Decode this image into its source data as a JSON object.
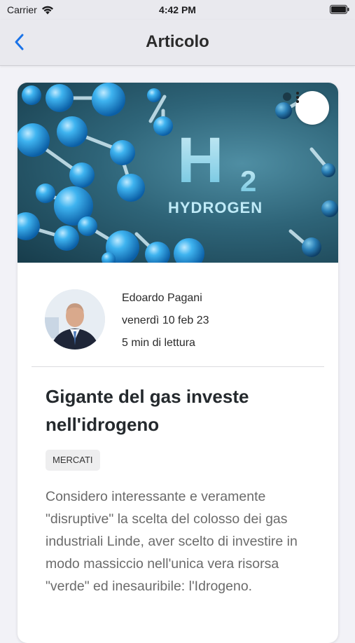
{
  "status_bar": {
    "carrier": "Carrier",
    "time": "4:42 PM"
  },
  "nav": {
    "title": "Articolo",
    "back_icon": "chevron-left-icon",
    "accent": "#1a73e8"
  },
  "article": {
    "hero": {
      "image_caption_h": "H",
      "image_caption_sub": "2",
      "image_caption_word": "HYDROGEN",
      "menu_icon": "more-vertical-icon"
    },
    "author": {
      "name": "Edoardo Pagani",
      "date": "venerdì 10 feb 23",
      "read_time": "5 min di lettura"
    },
    "title": "Gigante del gas investe nell'idrogeno",
    "category": "MERCATI",
    "excerpt": "Considero interessante e veramente \"disruptive\" la scelta del colosso dei gas industriali Linde, aver scelto di investire in modo massiccio nell'unica vera risorsa \"verde\" ed inesauribile: l'Idrogeno."
  }
}
